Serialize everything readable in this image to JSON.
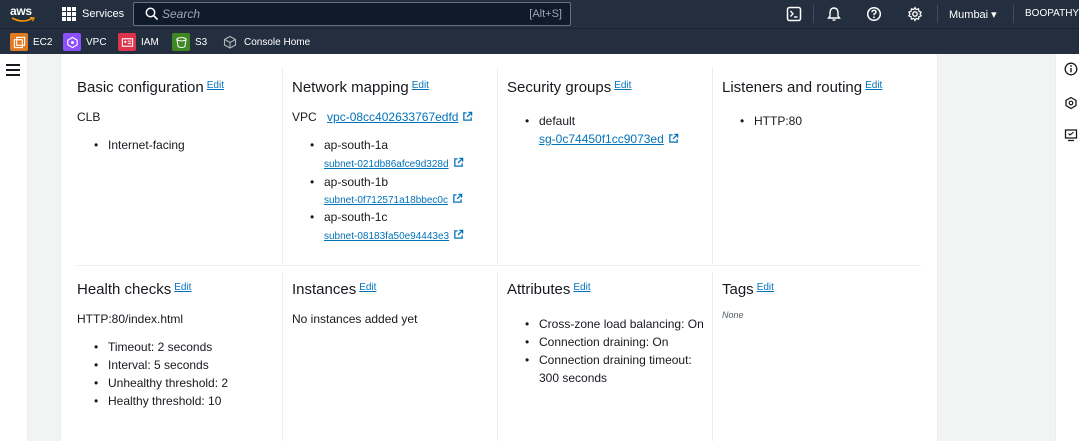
{
  "nav": {
    "logo_text": "aws",
    "services_label": "Services",
    "search_placeholder": "Search",
    "search_shortcut": "[Alt+S]",
    "region": "Mumbai ▾",
    "user": "BOOPATHY"
  },
  "favorites": [
    {
      "label": "EC2",
      "color": "#e07b24"
    },
    {
      "label": "VPC",
      "color": "#8c4fff"
    },
    {
      "label": "IAM",
      "color": "#dd344c"
    },
    {
      "label": "S3",
      "color": "#3f8624"
    },
    {
      "label": "Console Home",
      "color": "#414d5c"
    }
  ],
  "edit_label": "Edit",
  "sections": {
    "basic": {
      "title": "Basic configuration",
      "type": "CLB",
      "scheme": "Internet-facing"
    },
    "network": {
      "title": "Network mapping",
      "vpc_label": "VPC",
      "vpc_id": "vpc-08cc402633767edfd",
      "zones": [
        {
          "az": "ap-south-1a",
          "subnet": "subnet-021db86afce9d328d"
        },
        {
          "az": "ap-south-1b",
          "subnet": "subnet-0f712571a18bbec0c"
        },
        {
          "az": "ap-south-1c",
          "subnet": "subnet-08183fa50e94443e3"
        }
      ]
    },
    "security": {
      "title": "Security groups",
      "group_name": "default",
      "group_id": "sg-0c74450f1cc9073ed"
    },
    "listeners": {
      "title": "Listeners and routing",
      "items": [
        "HTTP:80"
      ]
    },
    "health": {
      "title": "Health checks",
      "target": "HTTP:80/index.html",
      "items": [
        "Timeout: 2 seconds",
        "Interval: 5 seconds",
        "Unhealthy threshold: 2",
        "Healthy threshold: 10"
      ]
    },
    "instances": {
      "title": "Instances",
      "text": "No instances added yet"
    },
    "attributes": {
      "title": "Attributes",
      "items": [
        "Cross-zone load balancing: On",
        "Connection draining: On",
        "Connection draining timeout:",
        "300 seconds"
      ]
    },
    "tags": {
      "title": "Tags",
      "text": "None"
    }
  },
  "colors": {
    "nav_bg": "#232f3e",
    "link": "#0073bb"
  }
}
